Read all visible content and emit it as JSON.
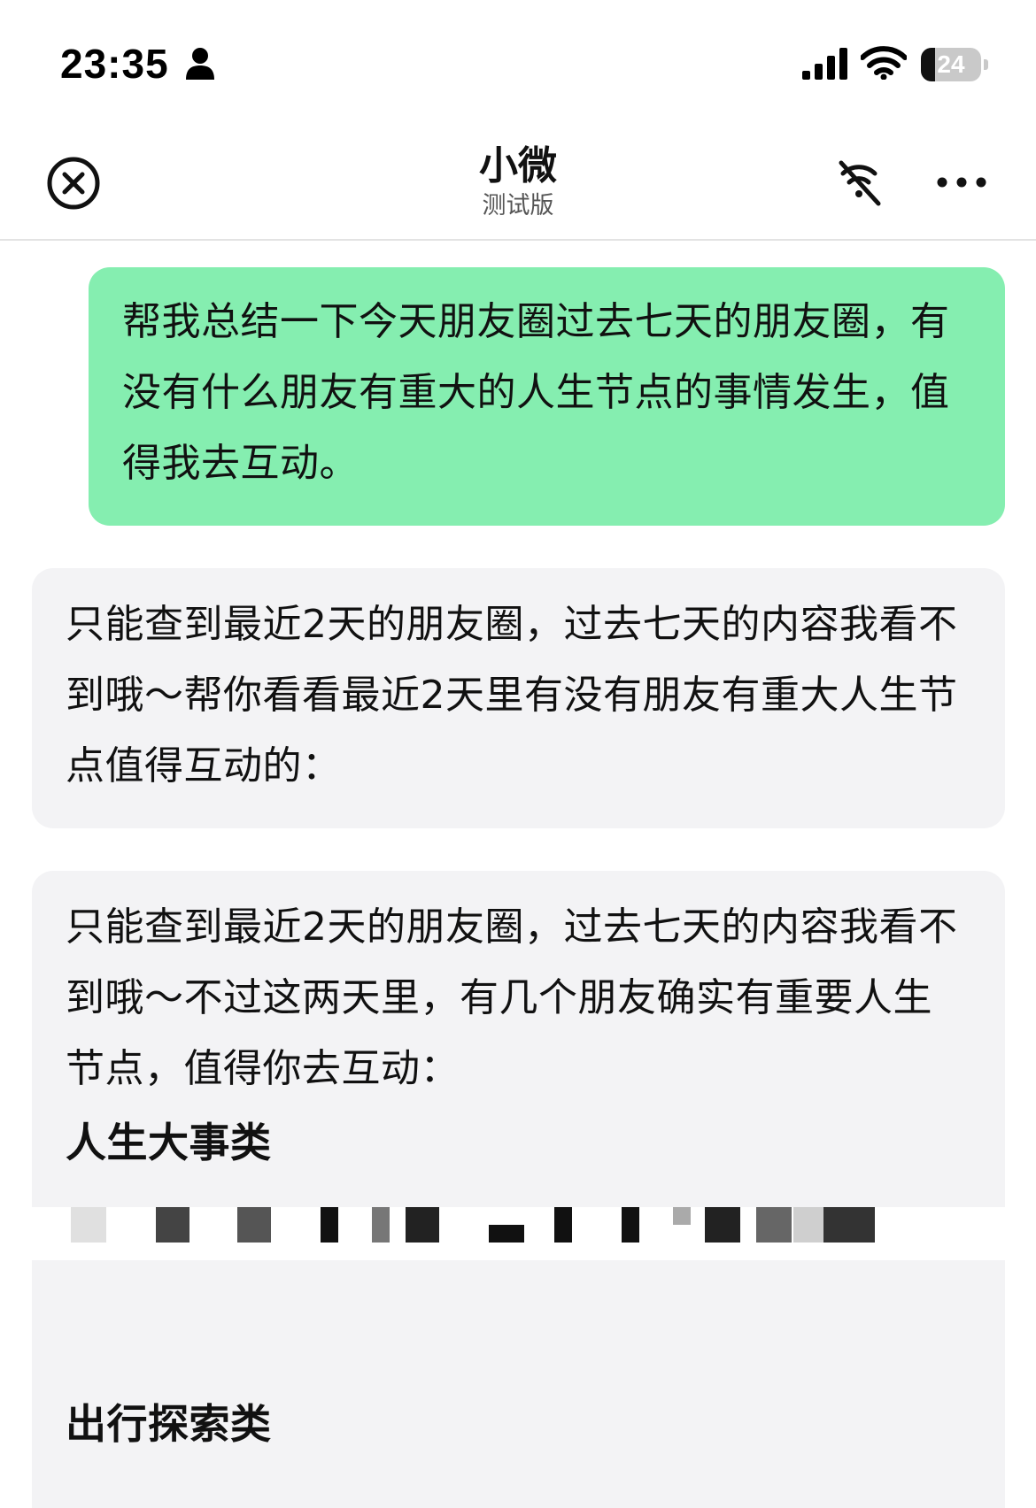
{
  "status_bar": {
    "time": "23:35",
    "battery_level": "24",
    "battery_fraction": 0.24
  },
  "nav": {
    "title": "小微",
    "subtitle": "测试版",
    "icons": {
      "close": "close-circle-icon",
      "mute": "muted-sound-icon",
      "more": "more-dots-icon"
    }
  },
  "messages": {
    "user": {
      "text": "帮我总结一下今天朋友圈过去七天的朋友圈，有没有什么朋友有重大的人生节点的事情发生，值得我去互动。"
    },
    "bot_1": {
      "text": "只能查到最近2天的朋友圈，过去七天的内容我看不到哦～帮你看看最近2天里有没有朋友有重大人生节点值得互动的："
    },
    "bot_2": {
      "intro": "只能查到最近2天的朋友圈，过去七天的内容我看不到哦～不过这两天里，有几个朋友确实有重要人生节点，值得你去互动：",
      "section_1": "人生大事类",
      "section_2": "出行探索类"
    }
  },
  "colors": {
    "user_bubble": "#85eeb0",
    "bot_bubble": "#f3f3f5",
    "text": "#111111"
  }
}
